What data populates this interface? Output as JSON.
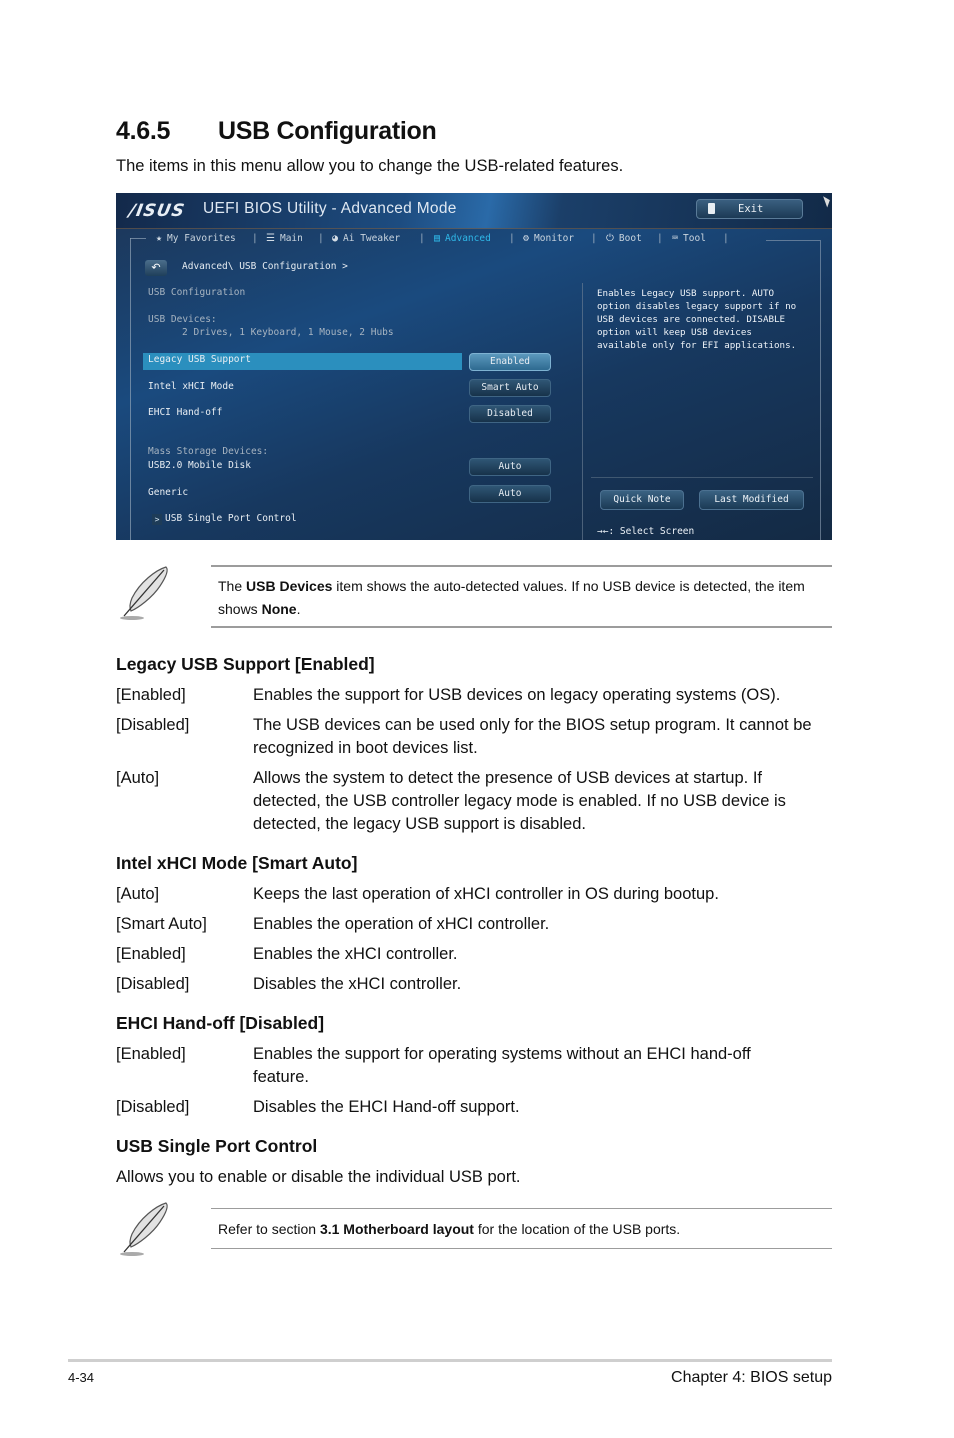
{
  "section": {
    "number": "4.6.5",
    "title": "USB Configuration",
    "intro": "The items in this menu allow you to change the USB-related features."
  },
  "bios": {
    "brand": "/ISUS",
    "title": "UEFI BIOS Utility - Advanced Mode",
    "exit_label": "Exit",
    "nav": [
      {
        "label": "My Favorites",
        "icon": "star-icon",
        "glyph": "★",
        "active": false
      },
      {
        "label": "Main",
        "icon": "list-icon",
        "glyph": "☰",
        "active": false
      },
      {
        "label": "Ai Tweaker",
        "icon": "tweaker-icon",
        "glyph": "◕",
        "active": false
      },
      {
        "label": "Advanced",
        "icon": "advanced-icon",
        "glyph": "▤",
        "active": true
      },
      {
        "label": "Monitor",
        "icon": "monitor-icon",
        "glyph": "⚙",
        "active": false
      },
      {
        "label": "Boot",
        "icon": "power-icon",
        "glyph": "⏻",
        "active": false
      },
      {
        "label": "Tool",
        "icon": "tool-icon",
        "glyph": "⌨",
        "active": false
      }
    ],
    "back_glyph": "↶",
    "breadcrumb": "Advanced\\ USB Configuration >",
    "page_heading": "USB Configuration",
    "usb_devices_label": "USB Devices:",
    "usb_devices_value": "2 Drives, 1 Keyboard, 1 Mouse, 2 Hubs",
    "settings": [
      {
        "label": "Legacy USB Support",
        "value": "Enabled",
        "selected": true
      },
      {
        "label": "Intel xHCI Mode",
        "value": "Smart Auto",
        "selected": false
      },
      {
        "label": "EHCI Hand-off",
        "value": "Disabled",
        "selected": false
      }
    ],
    "mass_storage_label": "Mass Storage Devices:",
    "mass_storage": [
      {
        "label": "USB2.0 Mobile Disk",
        "value": "Auto"
      },
      {
        "label": "Generic",
        "value": "Auto"
      }
    ],
    "submenu_glyph": ">",
    "submenu": "USB Single Port Control",
    "help_text": "Enables Legacy USB support. AUTO\noption disables legacy support if no\nUSB devices are connected. DISABLE\noption will keep USB devices\navailable only for EFI applications.",
    "quick_note": "Quick Note",
    "last_modified": "Last Modified",
    "select_screen": "→←: Select Screen"
  },
  "note1": {
    "pre": "The ",
    "bold1": "USB Devices",
    "mid": " item shows the auto-detected values. If no USB device is detected, the item shows ",
    "bold2": "None",
    "post": "."
  },
  "legacy": {
    "heading": "Legacy USB Support [Enabled]",
    "options": [
      {
        "key": "[Enabled]",
        "desc": "Enables the support for USB devices on legacy operating systems (OS)."
      },
      {
        "key": "[Disabled]",
        "desc": "The USB devices can be used only for the BIOS setup program. It cannot be recognized in boot devices list."
      },
      {
        "key": "[Auto]",
        "desc": "Allows the system to detect the presence of USB devices at startup. If detected, the USB controller legacy mode is enabled. If no USB device is detected, the legacy USB support is disabled."
      }
    ]
  },
  "xhci": {
    "heading": "Intel xHCI Mode [Smart Auto]",
    "options": [
      {
        "key": "[Auto]",
        "desc": "Keeps the last operation of xHCI controller in OS during bootup."
      },
      {
        "key": "[Smart Auto]",
        "desc": "Enables the operation of xHCI controller."
      },
      {
        "key": "[Enabled]",
        "desc": "Enables the xHCI controller."
      },
      {
        "key": "[Disabled]",
        "desc": "Disables the xHCI controller."
      }
    ]
  },
  "ehci": {
    "heading": "EHCI Hand-off [Disabled]",
    "options": [
      {
        "key": "[Enabled]",
        "desc": "Enables the support for operating systems without an EHCI hand-off feature."
      },
      {
        "key": "[Disabled]",
        "desc": "Disables the EHCI Hand-off support."
      }
    ]
  },
  "single_port": {
    "heading": "USB Single Port Control",
    "desc": "Allows you to enable or disable the individual USB port."
  },
  "note2": {
    "pre": "Refer to section ",
    "bold": "3.1 Motherboard layout",
    "post": " for the location of the USB ports."
  },
  "footer": {
    "page": "4-34",
    "chapter": "Chapter 4: BIOS setup"
  }
}
